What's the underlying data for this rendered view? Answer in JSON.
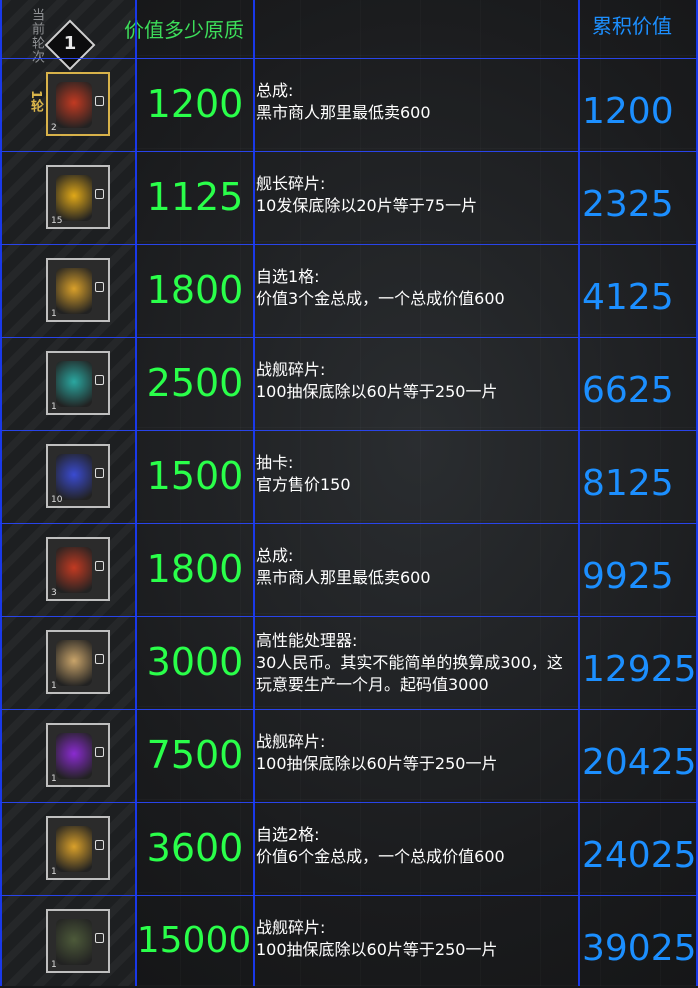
{
  "header": {
    "round_label": "当前轮次",
    "round_number": "1",
    "round_tag": "1轮",
    "value_col": "价值多少原质",
    "cumulative_col": "累积价值"
  },
  "rows": [
    {
      "value": "1200",
      "title": "总成:",
      "note": "黑市商人那里最低卖600",
      "cumulative": "1200",
      "qty": "2",
      "icon": "red-core-icon",
      "colors": {
        "art": "#c23a22",
        "border": "gold"
      }
    },
    {
      "value": "1125",
      "title": "舰长碎片:",
      "note": "10发保底除以20片等于75一片",
      "cumulative": "2325",
      "qty": "15",
      "icon": "gold-crystal-icon",
      "colors": {
        "art": "#e0a818",
        "border": "silver"
      }
    },
    {
      "value": "1800",
      "title": "自选1格:",
      "note": "价值3个金总成，一个总成价值600",
      "cumulative": "4125",
      "qty": "1",
      "icon": "gold-core-icon",
      "colors": {
        "art": "#d9a02a",
        "border": "silver"
      }
    },
    {
      "value": "2500",
      "title": "战舰碎片:",
      "note": "100抽保底除以60片等于250一片",
      "cumulative": "6625",
      "qty": "1",
      "icon": "teal-core-icon",
      "colors": {
        "art": "#2aa7a0",
        "border": "silver"
      }
    },
    {
      "value": "1500",
      "title": "抽卡:",
      "note": "官方售价150",
      "cumulative": "8125",
      "qty": "10",
      "icon": "blue-card-icon",
      "colors": {
        "art": "#3a4bd1",
        "border": "silver"
      }
    },
    {
      "value": "1800",
      "title": "总成:",
      "note": "黑市商人那里最低卖600",
      "cumulative": "9925",
      "qty": "3",
      "icon": "red-core-icon",
      "colors": {
        "art": "#c23a22",
        "border": "silver"
      }
    },
    {
      "value": "3000",
      "title": "高性能处理器:",
      "note": "30人民币。其实不能简单的换算成300，这玩意要生产一个月。起码值3000",
      "cumulative": "12925",
      "qty": "1",
      "icon": "processor-icon",
      "colors": {
        "art": "#c9a46a",
        "border": "silver"
      }
    },
    {
      "value": "7500",
      "title": "战舰碎片:",
      "note": "100抽保底除以60片等于250一片",
      "cumulative": "20425",
      "qty": "1",
      "icon": "purple-core-icon",
      "colors": {
        "art": "#8a2bd0",
        "border": "silver"
      }
    },
    {
      "value": "3600",
      "title": "自选2格:",
      "note": "价值6个金总成，一个总成价值600",
      "cumulative": "24025",
      "qty": "1",
      "icon": "gold-core-icon",
      "colors": {
        "art": "#d9a02a",
        "border": "silver"
      }
    },
    {
      "value": "15000",
      "title": "战舰碎片:",
      "note": "100抽保底除以60片等于250一片",
      "cumulative": "39025",
      "qty": "1",
      "icon": "dark-core-icon",
      "colors": {
        "art": "#4d5a3a",
        "border": "silver"
      }
    }
  ]
}
